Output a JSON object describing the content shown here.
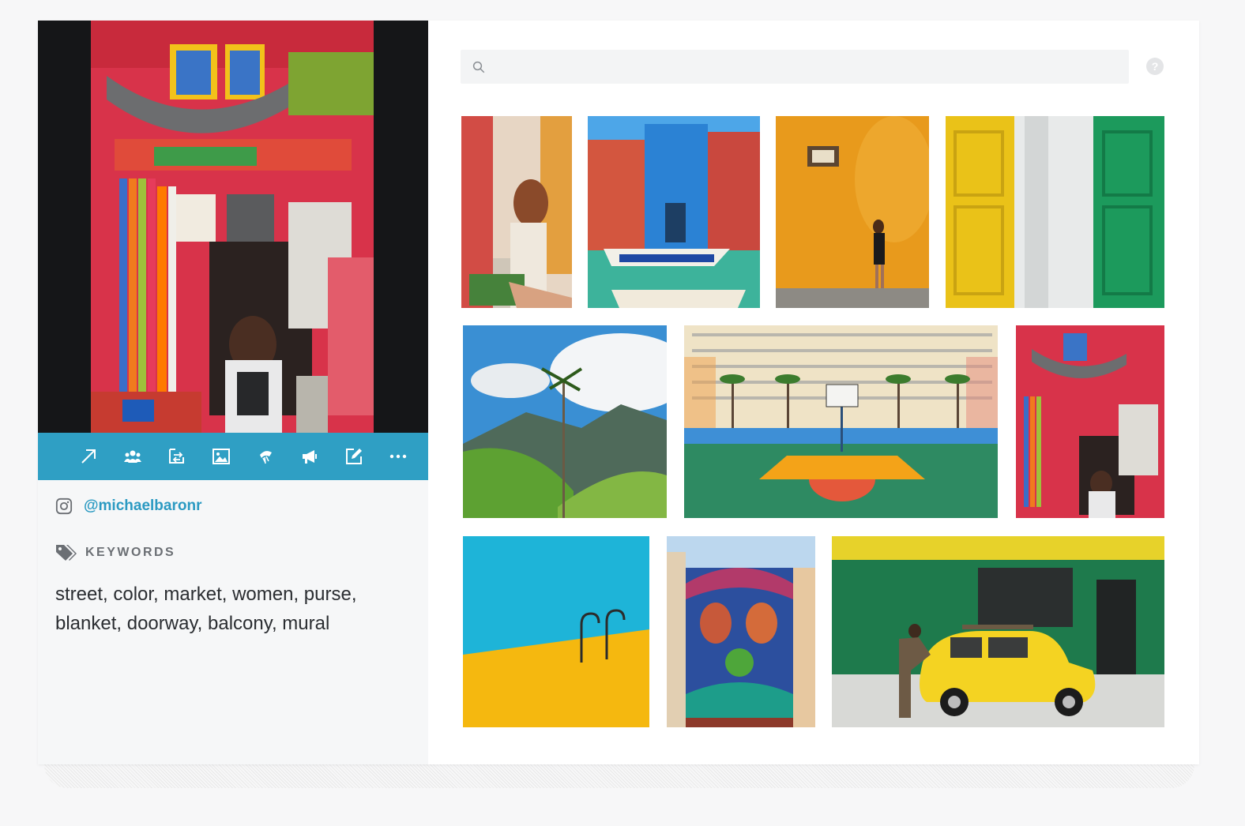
{
  "search": {
    "placeholder": ""
  },
  "help": {
    "label": "?"
  },
  "actions": [
    {
      "name": "share-icon"
    },
    {
      "name": "people-icon"
    },
    {
      "name": "swap-icon"
    },
    {
      "name": "image-icon"
    },
    {
      "name": "ban-icon"
    },
    {
      "name": "megaphone-icon"
    },
    {
      "name": "edit-icon"
    },
    {
      "name": "more-icon"
    }
  ],
  "photo": {
    "handle": "@michaelbaronr",
    "keywords_label": "KEYWORDS",
    "keywords": "street, color, market, women, purse, blanket, doorway, balcony, mural"
  },
  "gallery": [
    {
      "name": "thumb-stairs-hand"
    },
    {
      "name": "thumb-burano-houses"
    },
    {
      "name": "thumb-orange-wall"
    },
    {
      "name": "thumb-colored-doors"
    },
    {
      "name": "thumb-palm-valley"
    },
    {
      "name": "thumb-basketball-court"
    },
    {
      "name": "thumb-market-storefront"
    },
    {
      "name": "thumb-pool-ladder"
    },
    {
      "name": "thumb-street-mural"
    },
    {
      "name": "thumb-yellow-car"
    }
  ],
  "colors": {
    "accent": "#2f9fc4",
    "link": "#2b9ac2"
  }
}
